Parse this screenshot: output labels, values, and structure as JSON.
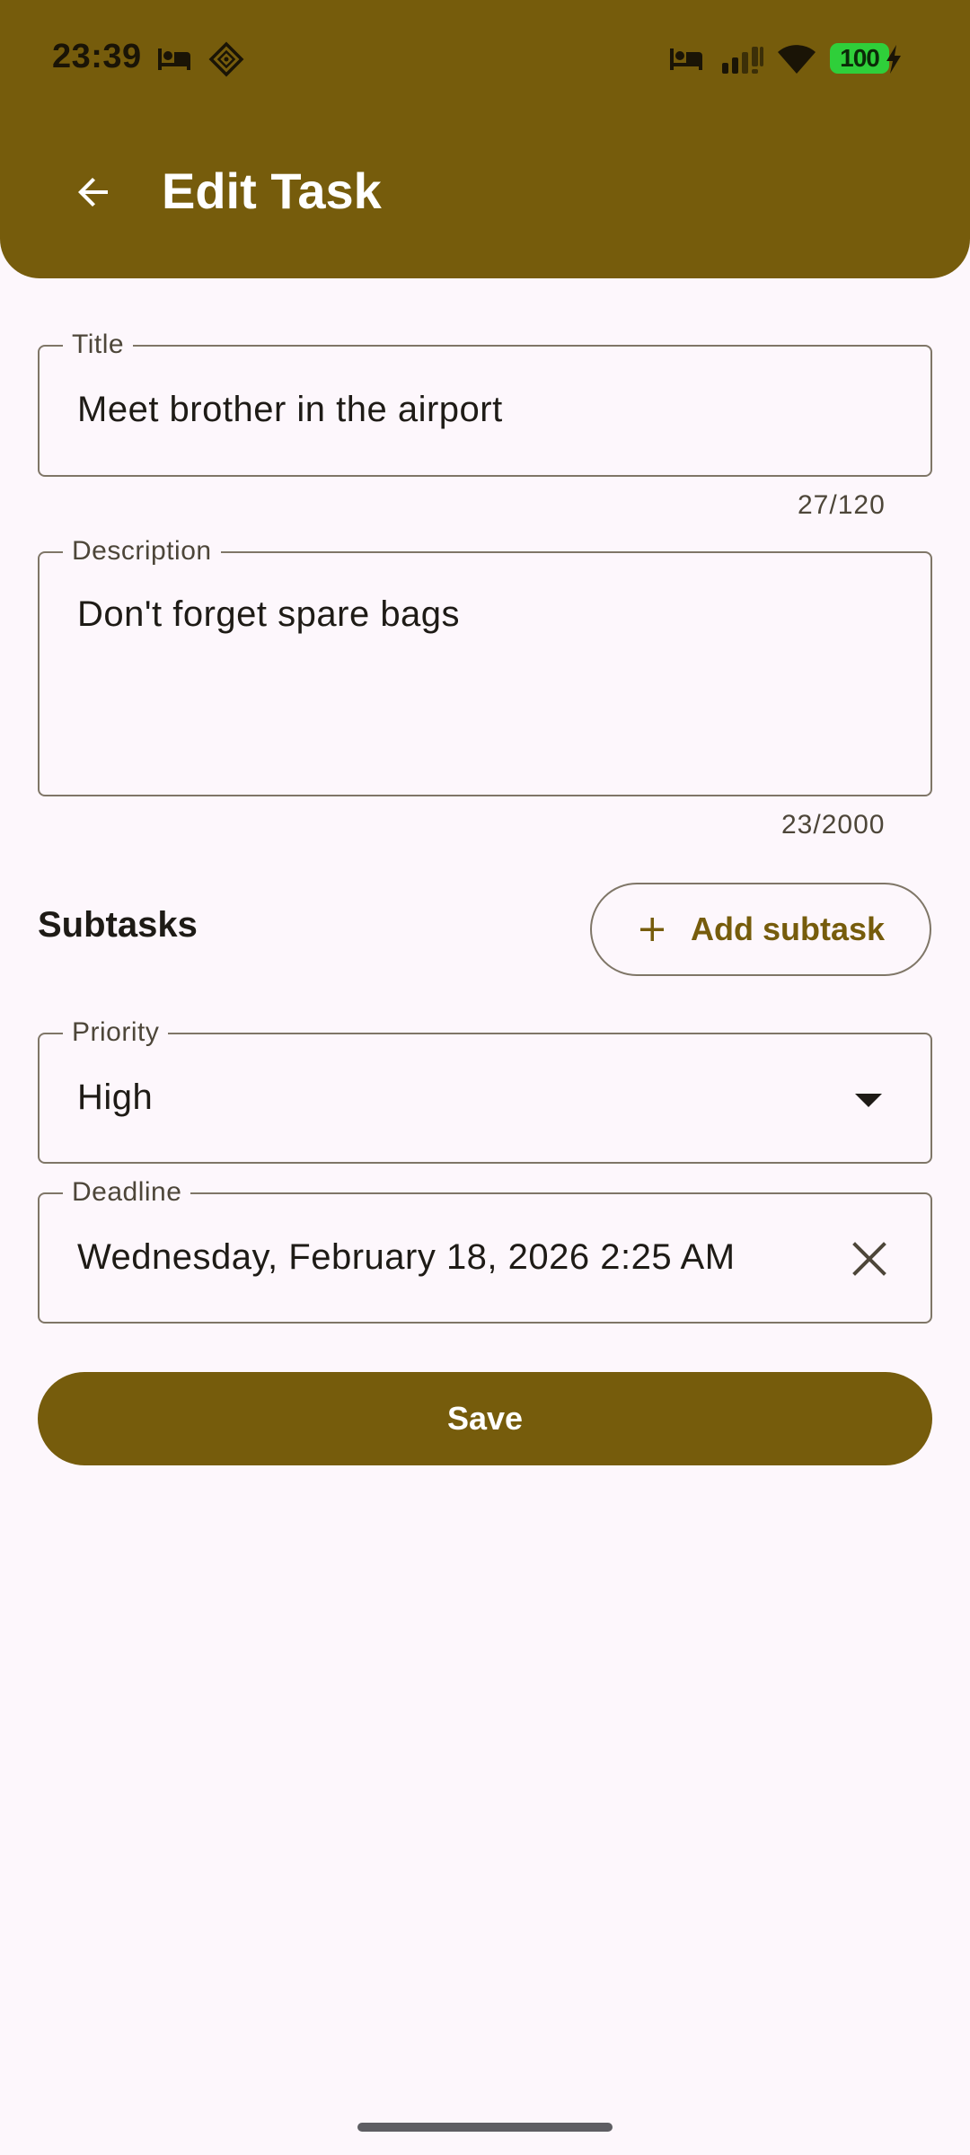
{
  "status_bar": {
    "time": "23:39",
    "battery": "100",
    "left_icons": [
      "bed-icon",
      "data-saver-icon"
    ],
    "right_icons": [
      "bed-icon",
      "signal-icon",
      "wifi-icon",
      "battery-icon",
      "charging-bolt-icon"
    ]
  },
  "app_bar": {
    "title": "Edit Task",
    "back_icon": "arrow-back-icon",
    "color": "#765c0c"
  },
  "form": {
    "title": {
      "label": "Title",
      "value": "Meet brother in the airport",
      "counter": "27/120"
    },
    "description": {
      "label": "Description",
      "value": "Don't forget spare bags",
      "counter": "23/2000"
    },
    "subtasks": {
      "label": "Subtasks",
      "add_button": "Add subtask",
      "add_icon": "plus-icon"
    },
    "priority": {
      "label": "Priority",
      "value": "High",
      "dropdown_icon": "arrow-drop-down-icon"
    },
    "deadline": {
      "label": "Deadline",
      "value": "Wednesday, February 18, 2026 2:25 AM",
      "clear_icon": "close-icon"
    },
    "save_label": "Save"
  },
  "colors": {
    "primary": "#765c0c",
    "background": "#fdf7fc",
    "outline": "#7f7667",
    "battery": "#2fcf3a"
  }
}
